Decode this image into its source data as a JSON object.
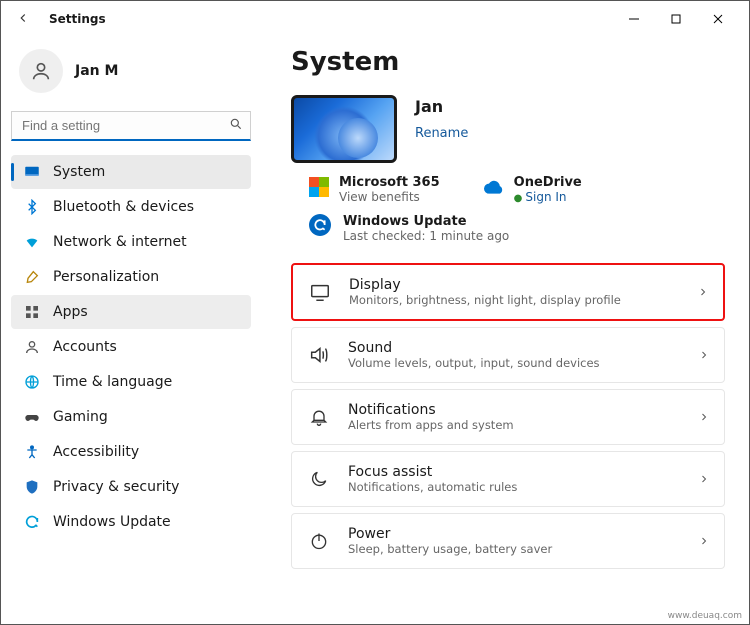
{
  "window": {
    "title": "Settings"
  },
  "user": {
    "name": "Jan M"
  },
  "search": {
    "placeholder": "Find a setting"
  },
  "sidebar": {
    "items": [
      {
        "label": "System"
      },
      {
        "label": "Bluetooth & devices"
      },
      {
        "label": "Network & internet"
      },
      {
        "label": "Personalization"
      },
      {
        "label": "Apps"
      },
      {
        "label": "Accounts"
      },
      {
        "label": "Time & language"
      },
      {
        "label": "Gaming"
      },
      {
        "label": "Accessibility"
      },
      {
        "label": "Privacy & security"
      },
      {
        "label": "Windows Update"
      }
    ]
  },
  "page": {
    "heading": "System",
    "device_name": "Jan",
    "rename_label": "Rename",
    "services": {
      "ms365": {
        "title": "Microsoft 365",
        "sub": "View benefits"
      },
      "onedrive": {
        "title": "OneDrive",
        "sub": "Sign In"
      }
    },
    "update": {
      "title": "Windows Update",
      "sub": "Last checked: 1 minute ago"
    },
    "cards": [
      {
        "title": "Display",
        "sub": "Monitors, brightness, night light, display profile"
      },
      {
        "title": "Sound",
        "sub": "Volume levels, output, input, sound devices"
      },
      {
        "title": "Notifications",
        "sub": "Alerts from apps and system"
      },
      {
        "title": "Focus assist",
        "sub": "Notifications, automatic rules"
      },
      {
        "title": "Power",
        "sub": "Sleep, battery usage, battery saver"
      }
    ]
  },
  "watermark": "www.deuaq.com"
}
